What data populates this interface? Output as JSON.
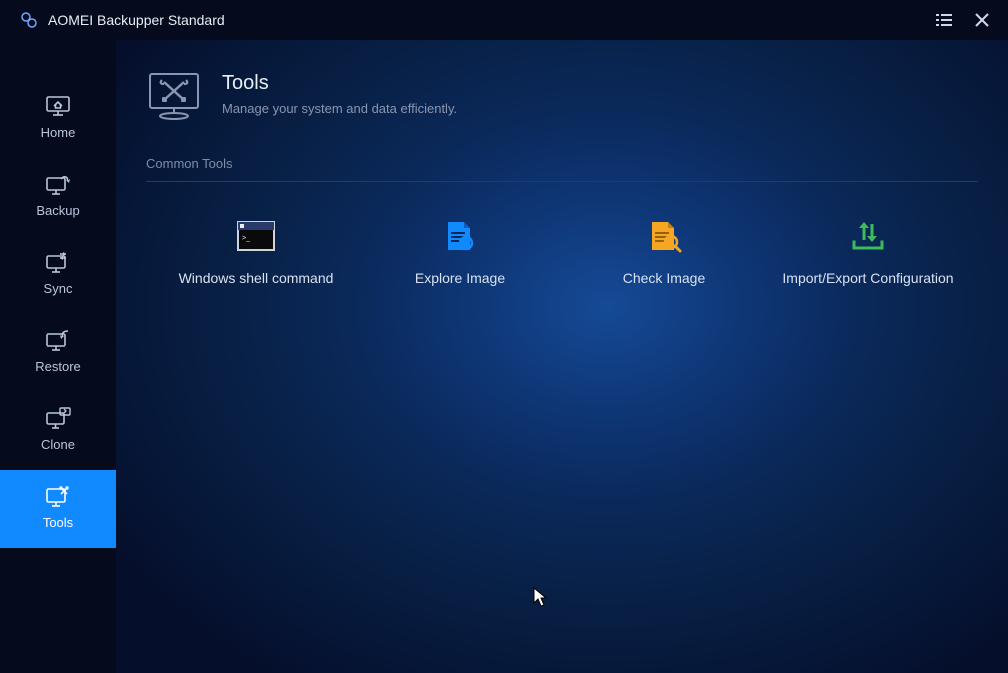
{
  "app": {
    "title": "AOMEI Backupper Standard"
  },
  "sidebar": {
    "items": [
      {
        "label": "Home"
      },
      {
        "label": "Backup"
      },
      {
        "label": "Sync"
      },
      {
        "label": "Restore"
      },
      {
        "label": "Clone"
      },
      {
        "label": "Tools"
      }
    ]
  },
  "page": {
    "title": "Tools",
    "subtitle": "Manage your system and data efficiently."
  },
  "section": {
    "common_tools_label": "Common Tools"
  },
  "tools": [
    {
      "label": "Windows shell command"
    },
    {
      "label": "Explore Image"
    },
    {
      "label": "Check Image"
    },
    {
      "label": "Import/Export Configuration"
    }
  ]
}
